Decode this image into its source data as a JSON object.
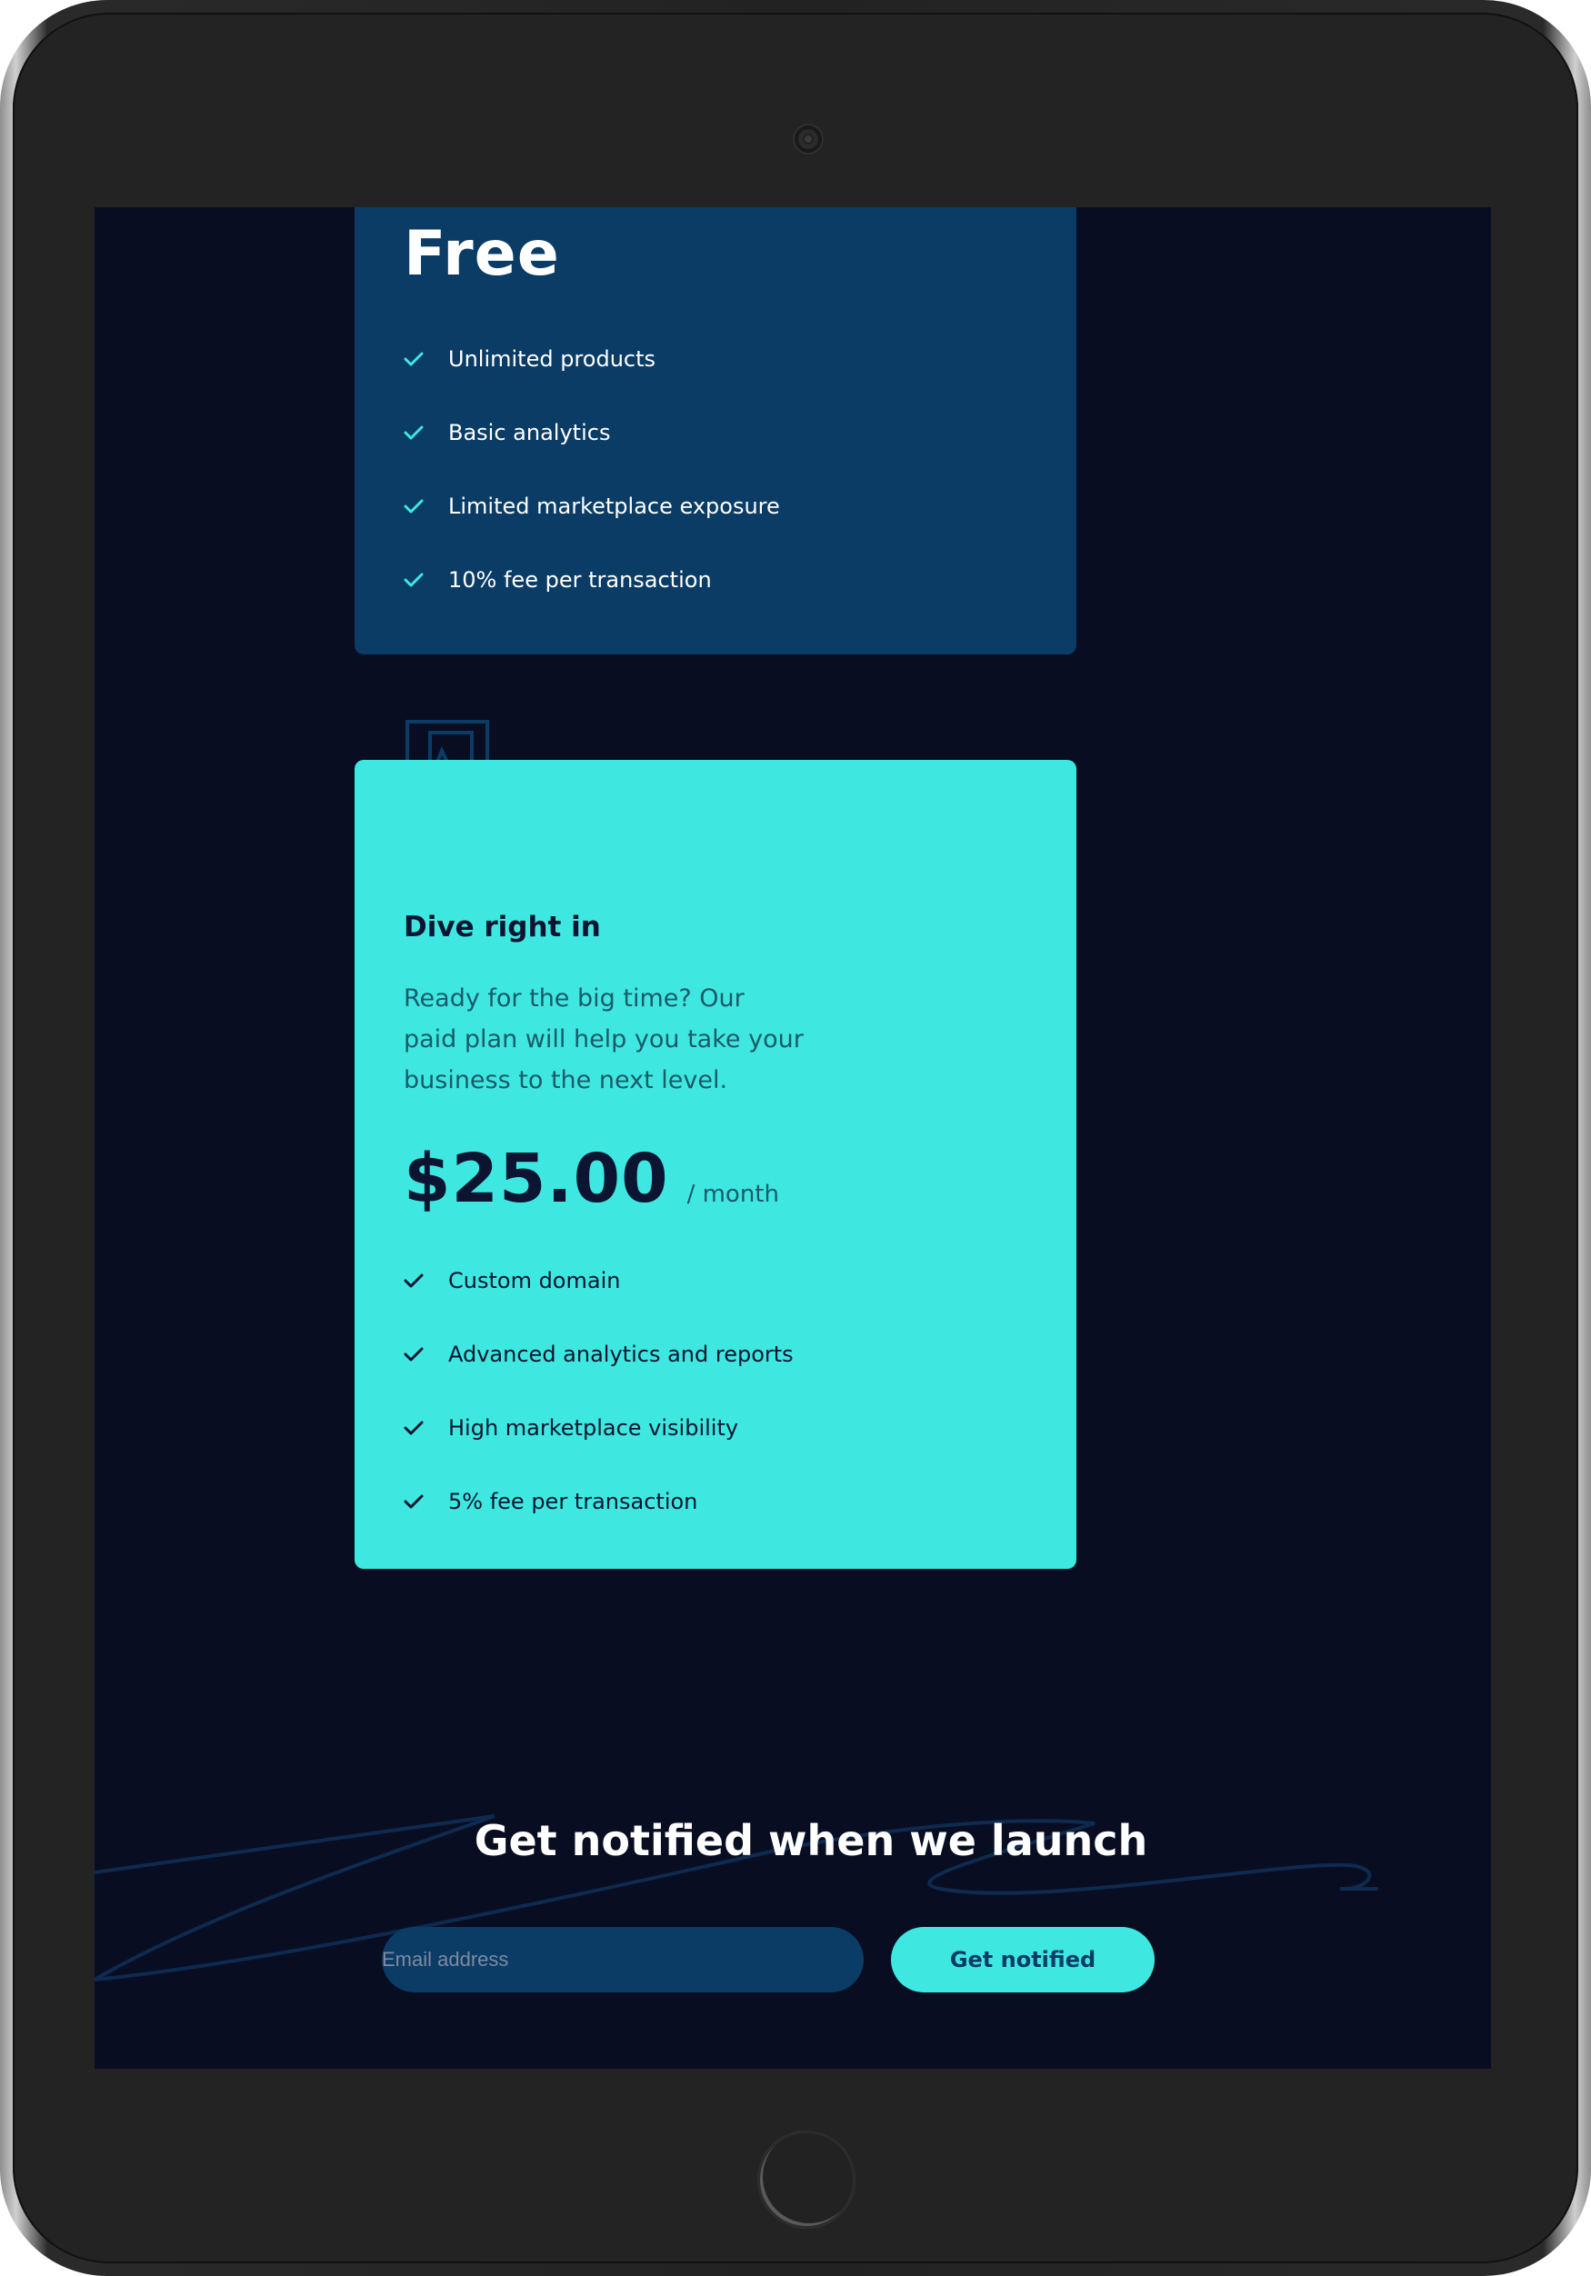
{
  "colors": {
    "page_bg": "#080d22",
    "free_card": "#0a3c66",
    "accent": "#3ee8e0",
    "dark_text": "#0b1430"
  },
  "free_plan": {
    "title": "Free",
    "features": [
      "Unlimited products",
      "Basic analytics",
      "Limited marketplace exposure",
      "10% fee per transaction"
    ]
  },
  "paid_plan": {
    "icon": "plan-icon",
    "title": "Dive right in",
    "description": "Ready for the big time? Our paid plan will help you take your business to the next level.",
    "price": "$25.00",
    "period": "/ month",
    "features": [
      "Custom domain",
      "Advanced analytics and reports",
      "High marketplace visibility",
      "5% fee per transaction"
    ]
  },
  "notify": {
    "title": "Get notified when we launch",
    "email_placeholder": "Email address",
    "email_value": "",
    "button_label": "Get notified"
  }
}
